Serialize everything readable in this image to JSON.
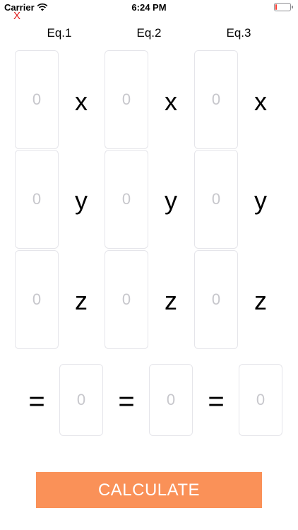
{
  "status_bar": {
    "carrier": "Carrier",
    "time": "6:24 PM",
    "battery_level": 0.1
  },
  "close_label": "X",
  "equations": [
    {
      "header": "Eq.1",
      "x_coef": "0",
      "y_coef": "0",
      "z_coef": "0",
      "constant": "0"
    },
    {
      "header": "Eq.2",
      "x_coef": "0",
      "y_coef": "0",
      "z_coef": "0",
      "constant": "0"
    },
    {
      "header": "Eq.3",
      "x_coef": "0",
      "y_coef": "0",
      "z_coef": "0",
      "constant": "0"
    }
  ],
  "variables": {
    "x": "x",
    "y": "y",
    "z": "z"
  },
  "equals_label": "=",
  "calculate_label": "CALCULATE",
  "colors": {
    "accent": "#fa9158",
    "close": "#e02020",
    "placeholder": "#c7c7cc",
    "box_border": "#e5e5ea"
  }
}
